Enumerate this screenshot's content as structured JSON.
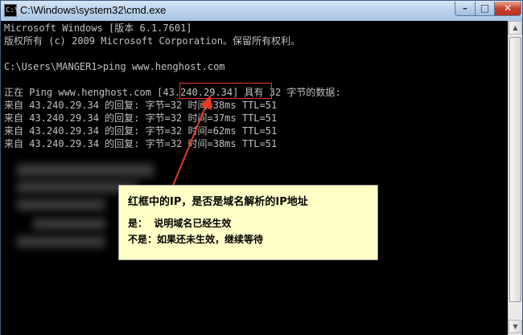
{
  "window": {
    "title": "C:\\Windows\\system32\\cmd.exe",
    "app_icon": "C:\\"
  },
  "console": {
    "lines": [
      "Microsoft Windows [版本 6.1.7601]",
      "版权所有 (c) 2009 Microsoft Corporation。保留所有权利。",
      "",
      "C:\\Users\\MANGER1>ping www.henghost.com",
      "",
      "正在 Ping www.henghost.com [43.240.29.34] 具有 32 字节的数据:",
      "来自 43.240.29.34 的回复: 字节=32 时间=38ms TTL=51",
      "来自 43.240.29.34 的回复: 字节=32 时间=37ms TTL=51",
      "来自 43.240.29.34 的回复: 字节=32 时间=62ms TTL=51",
      "来自 43.240.29.34 的回复: 字节=32 时间=38ms TTL=51"
    ]
  },
  "callout": {
    "title": "红框中的IP，是否是域名解析的IP地址",
    "yes": "是：  说明域名已经生效",
    "no": "不是：如果还未生效，继续等待"
  },
  "colors": {
    "highlight": "#e53a28",
    "callout_bg": "#ffffc6",
    "console_text": "#c0c0c0"
  }
}
